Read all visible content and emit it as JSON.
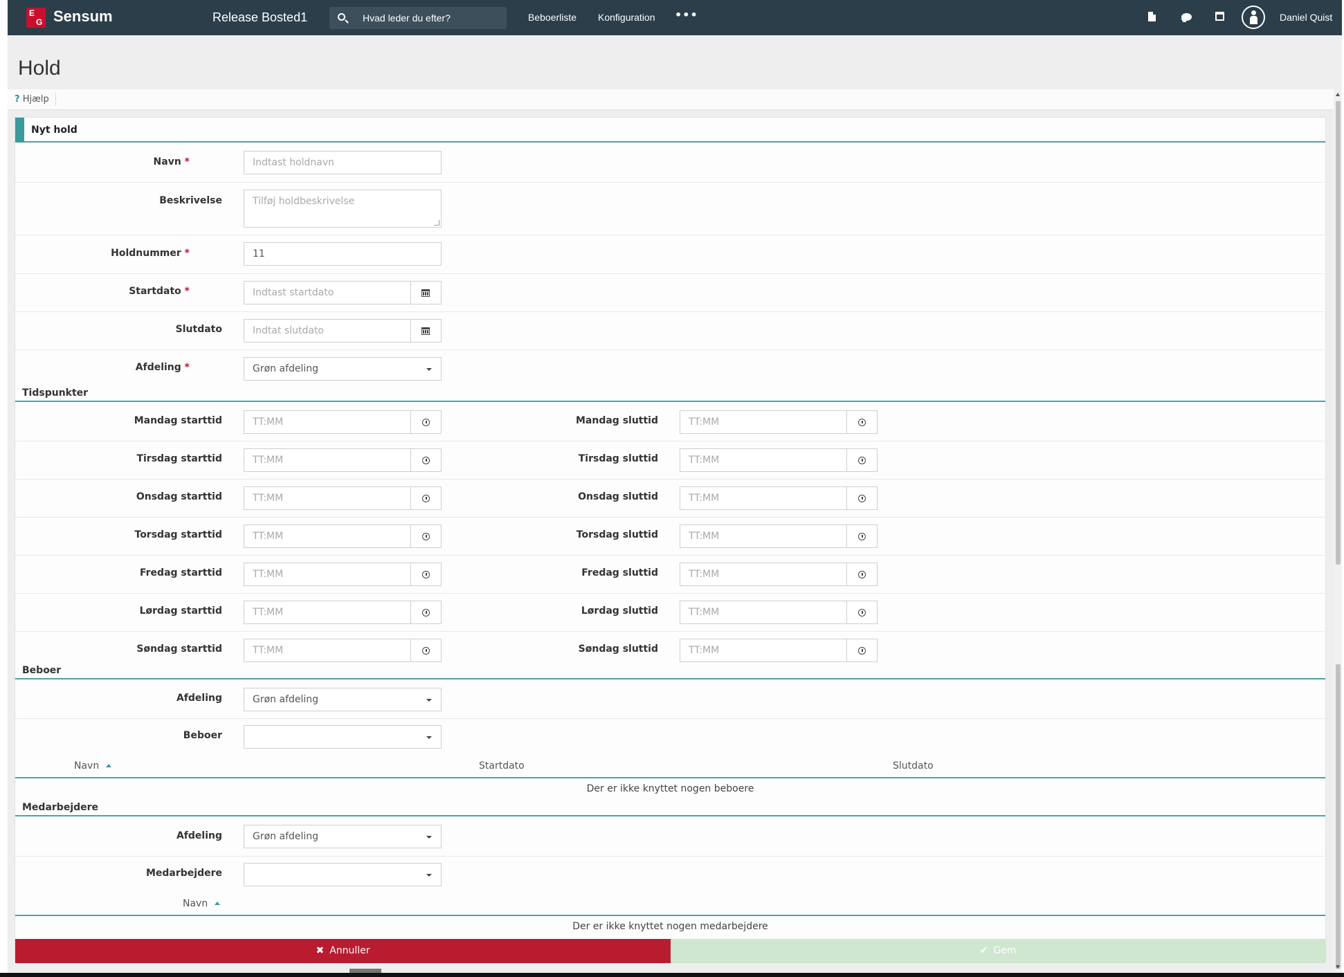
{
  "topbar": {
    "logo_top": "E",
    "logo_bottom": "G",
    "brand": "Sensum",
    "release": "Release Bosted1",
    "search_placeholder": "Hvad leder du efter?",
    "nav": [
      "Beboerliste",
      "Konfiguration"
    ],
    "more": "•••",
    "user": "Daniel Quist"
  },
  "page": {
    "title": "Hold",
    "help": "Hjælp",
    "help_mark": "?"
  },
  "form": {
    "title": "Nyt hold",
    "navn": {
      "label": "Navn",
      "placeholder": "Indtast holdnavn"
    },
    "beskrivelse": {
      "label": "Beskrivelse",
      "placeholder": "Tilføj holdbeskrivelse"
    },
    "holdnummer": {
      "label": "Holdnummer",
      "value": "11"
    },
    "startdato": {
      "label": "Startdato",
      "placeholder": "Indtast startdato"
    },
    "slutdato": {
      "label": "Slutdato",
      "placeholder": "Indtat slutdato"
    },
    "afdeling": {
      "label": "Afdeling",
      "value": "Grøn afdeling"
    },
    "required_mark": "*"
  },
  "tidspunkter": {
    "title": "Tidspunkter",
    "time_placeholder": "TT:MM",
    "days": [
      {
        "start": "Mandag starttid",
        "end": "Mandag sluttid"
      },
      {
        "start": "Tirsdag starttid",
        "end": "Tirsdag sluttid"
      },
      {
        "start": "Onsdag starttid",
        "end": "Onsdag sluttid"
      },
      {
        "start": "Torsdag starttid",
        "end": "Torsdag sluttid"
      },
      {
        "start": "Fredag starttid",
        "end": "Fredag sluttid"
      },
      {
        "start": "Lørdag starttid",
        "end": "Lørdag sluttid"
      },
      {
        "start": "Søndag starttid",
        "end": "Søndag sluttid"
      }
    ]
  },
  "beboer": {
    "title": "Beboer",
    "afdeling_label": "Afdeling",
    "afdeling_value": "Grøn afdeling",
    "beboer_label": "Beboer",
    "beboer_value": "",
    "columns": [
      "Navn",
      "Startdato",
      "Slutdato"
    ],
    "empty": "Der er ikke knyttet nogen beboere"
  },
  "medarbejdere": {
    "title": "Medarbejdere",
    "afdeling_label": "Afdeling",
    "afdeling_value": "Grøn afdeling",
    "medarbejdere_label": "Medarbejdere",
    "medarbejdere_value": "",
    "columns": [
      "Navn"
    ],
    "empty": "Der er ikke knyttet nogen medarbejdere"
  },
  "actions": {
    "cancel": "Annuller",
    "save": "Gem"
  },
  "colors": {
    "topbar": "#2b3e4a",
    "accent": "#3b9a9c",
    "cancel": "#b91c2f",
    "save_disabled": "#cfe6cf",
    "required": "#c8102e"
  },
  "icons": [
    "search-icon",
    "document-icon",
    "chat-icon",
    "calendar-icon",
    "user-avatar-icon",
    "calendar-icon",
    "clock-icon",
    "caret-down-icon",
    "sort-asc-icon",
    "close-icon",
    "check-icon"
  ]
}
